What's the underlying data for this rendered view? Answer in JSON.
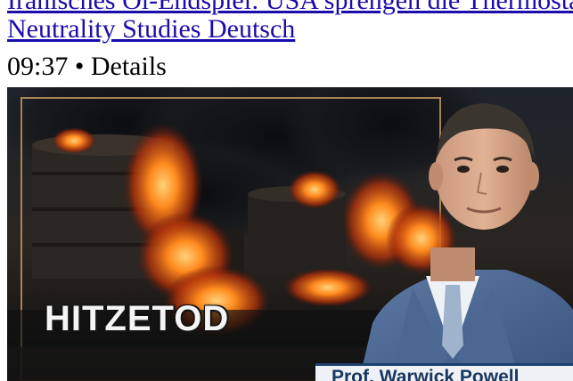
{
  "video": {
    "title": "Iranisches Öl-Endspiel: USA sprengen die Thermostate",
    "channel": "Neutrality Studies Deutsch",
    "duration": "09:37",
    "separator": "•",
    "details_label": "Details"
  },
  "thumbnail": {
    "overlay_title": "HITZETOD",
    "name_plate": "Prof. Warwick Powell"
  }
}
